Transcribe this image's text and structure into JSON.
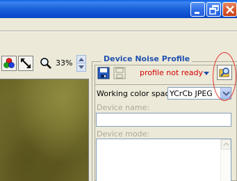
{
  "zoom": {
    "value": "33%"
  },
  "panel": {
    "title": "Device Noise Profile",
    "profile_status": "profile not ready",
    "working_color_space_label": "Working color space:",
    "working_color_space_value": "YCrCb JPEG",
    "device_name_label": "Device name:",
    "device_name_value": "",
    "device_mode_label": "Device mode:",
    "device_mode_value": ""
  },
  "colors": {
    "titlebar": "#1E64DC",
    "panel_title": "#2151B0",
    "status_text": "#D40000",
    "annotation": "#E0322E"
  },
  "icons": [
    "minimize-icon",
    "restore-icon",
    "close-icon",
    "color-channels-icon",
    "fit-to-window-icon",
    "magnifier-icon",
    "save-profile-icon",
    "save-disabled-icon",
    "open-profile-icon"
  ]
}
